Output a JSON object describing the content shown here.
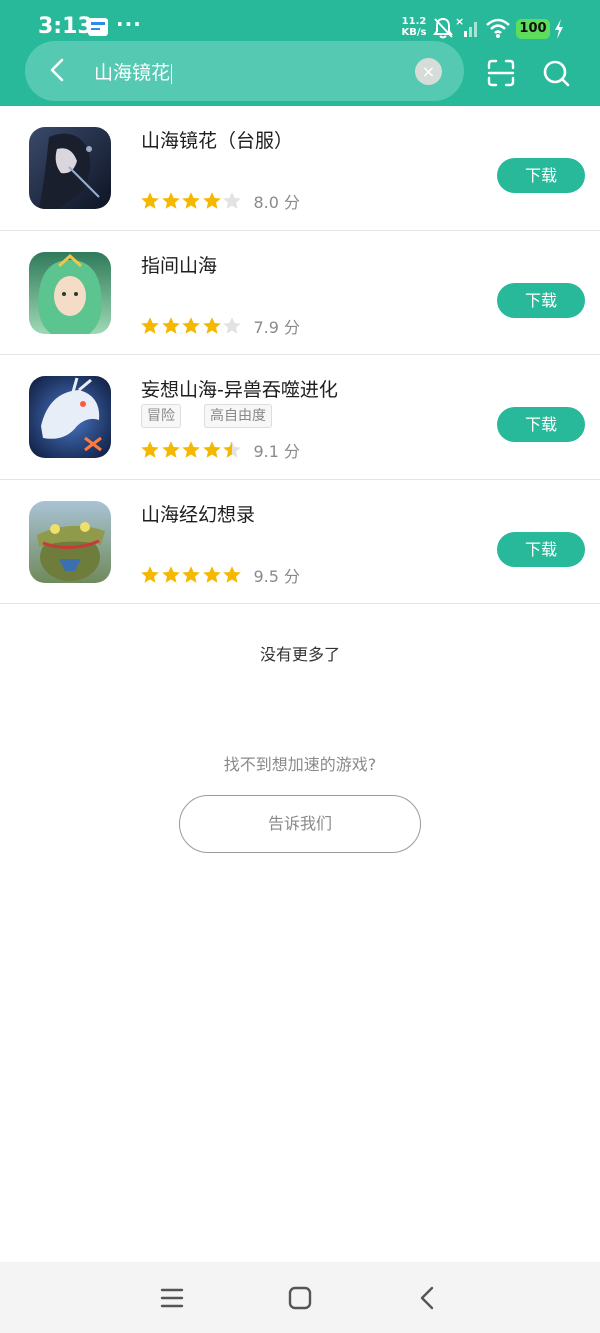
{
  "status_bar": {
    "time": "3:13",
    "dots": "···",
    "net_speed_value": "11.2",
    "net_speed_unit": "KB/s",
    "battery": "100"
  },
  "search": {
    "query": "山海镜花",
    "clear_symbol": "×"
  },
  "results": [
    {
      "name": "山海镜花（台服）",
      "tags": [],
      "stars": 4,
      "score": "8.0 分",
      "button": "下载"
    },
    {
      "name": "指间山海",
      "tags": [],
      "stars": 4,
      "score": "7.9 分",
      "button": "下载"
    },
    {
      "name": "妄想山海-异兽吞噬进化",
      "tags": [
        "冒险",
        "高自由度"
      ],
      "stars": 4.5,
      "score": "9.1 分",
      "button": "下载"
    },
    {
      "name": "山海经幻想录",
      "tags": [],
      "stars": 5,
      "score": "9.5 分",
      "button": "下载"
    }
  ],
  "footer": {
    "no_more": "没有更多了",
    "cant_find": "找不到想加速的游戏?",
    "tell_us": "告诉我们"
  },
  "colors": {
    "accent": "#27b99a",
    "star": "#f5b800",
    "star_empty": "#e2e2e2"
  }
}
